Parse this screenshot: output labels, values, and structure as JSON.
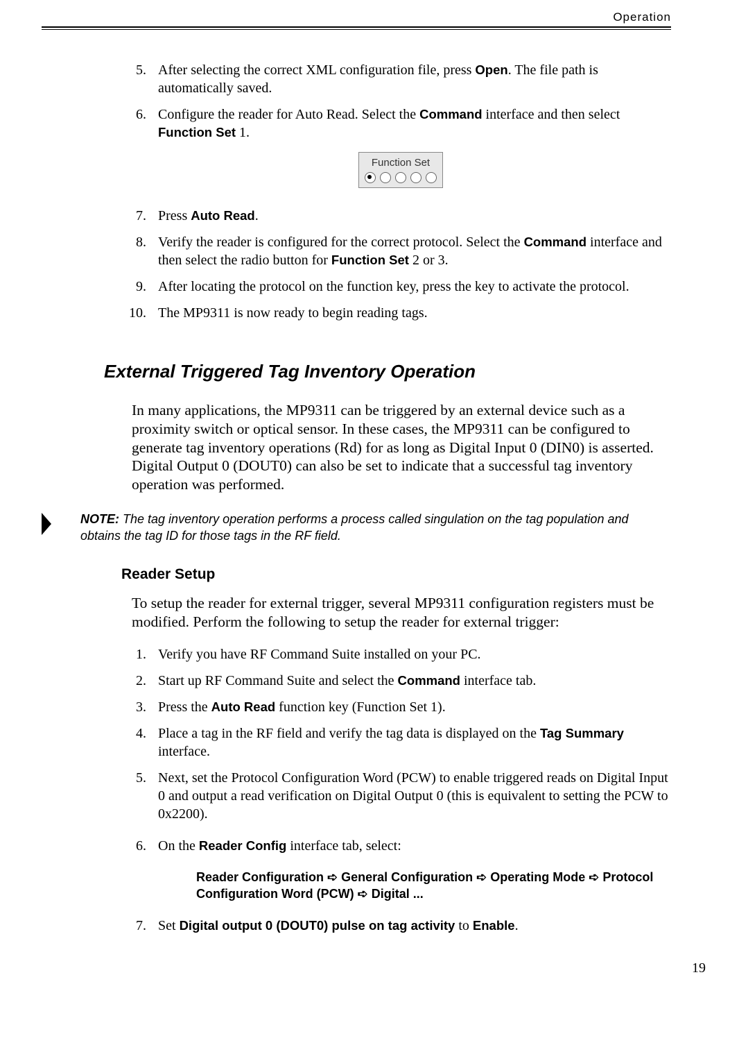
{
  "header": {
    "running_title": "Operation",
    "page_number": "19"
  },
  "list1": {
    "start": 5,
    "items": {
      "5_a": "After selecting the correct XML configuration file, press ",
      "5_b": "Open",
      "5_c": ". The file path is automatically saved.",
      "6_a": "Configure the reader for Auto Read. Select the ",
      "6_b": "Command",
      "6_c": " interface and then select ",
      "6_d": "Function Set",
      "6_e": " 1.",
      "7_a": "Press  ",
      "7_b": "Auto Read",
      "7_c": ".",
      "8_a": "Verify the reader is configured for the correct protocol. Select the ",
      "8_b": "Command",
      "8_c": " interface and then select the radio button for ",
      "8_d": "Function Set",
      "8_e": " 2 or 3.",
      "9": "After locating the protocol on the function key, press the key to activate the protocol.",
      "10": "The MP9311 is now ready to begin reading tags."
    }
  },
  "function_set_widget": {
    "label": "Function Set",
    "options": 5,
    "selected_index": 0
  },
  "section2": {
    "heading": "External Triggered Tag Inventory Operation",
    "para": "In many applications, the MP9311 can be triggered by an external device such as a proximity switch or optical sensor. In these cases, the MP9311 can be configured to generate tag inventory operations (Rd) for as long as Digital Input 0 (DIN0) is asserted. Digital Output 0 (DOUT0) can also be set to indicate that a successful tag inventory operation was performed."
  },
  "note": {
    "label": "NOTE:",
    "text": "The tag inventory operation performs a process called singulation on the tag population and obtains the tag ID for those tags in the RF field."
  },
  "section3": {
    "heading": "Reader Setup",
    "para": "To setup the reader for external trigger, several MP9311 configuration registers must be modified. Perform the following to setup the reader for external trigger:"
  },
  "list2": {
    "items": {
      "1": "Verify you have RF Command Suite installed on your PC.",
      "2_a": "Start up RF Command Suite and select the ",
      "2_b": "Command",
      "2_c": " interface tab.",
      "3_a": "Press the ",
      "3_b": "Auto Read",
      "3_c": " function key (Function Set 1).",
      "4_a": "Place a tag in the RF field and verify the tag data is displayed on the ",
      "4_b": "Tag Summary",
      "4_c": " interface.",
      "5": "Next, set the Protocol Configuration Word (PCW) to enable triggered reads on Digital Input 0 and output a read verification on Digital Output 0 (this is equivalent to setting the PCW to 0x2200).",
      "6_a": "On the ",
      "6_b": "Reader Config",
      "6_c": " interface tab, select:",
      "7_a": "Set ",
      "7_b": "Digital output 0 (DOUT0) pulse on tag activity",
      "7_c": " to ",
      "7_d": "Enable",
      "7_e": "."
    }
  },
  "config_path": {
    "p1": "Reader Configuration ",
    "p2": " General Configuration  ",
    "p3": "  Operating Mode  ",
    "p4": "  Protocol Configuration Word (PCW) ",
    "p5": " Digital ...",
    "arrow": "➪"
  }
}
